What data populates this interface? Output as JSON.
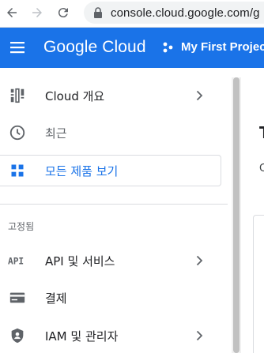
{
  "browser": {
    "url": "console.cloud.google.com/g",
    "back_icon": "arrow-left-icon",
    "forward_icon": "arrow-right-icon",
    "reload_icon": "reload-icon",
    "lock_icon": "lock-icon"
  },
  "header": {
    "bg_color": "#1a73e8",
    "logo_text": "Google Cloud",
    "project_label": "My First Project",
    "menu_icon": "hamburger-menu-icon",
    "project_icon": "project-dots-icon"
  },
  "sidenav": {
    "items": [
      {
        "label": "Cloud 개요",
        "icon": "dashboard-icon",
        "has_chevron": true
      },
      {
        "label": "최근",
        "icon": "clock-icon",
        "has_chevron": false
      },
      {
        "label": "모든 제품 보기",
        "icon": "grid-icon",
        "has_chevron": false
      }
    ],
    "pinned_section_label": "고정됨",
    "pinned_items": [
      {
        "label": "API 및 서비스",
        "icon": "api-icon",
        "has_chevron": true
      },
      {
        "label": "결제",
        "icon": "billing-icon",
        "has_chevron": false
      },
      {
        "label": "IAM 및 관리자",
        "icon": "shield-icon",
        "has_chevron": true
      }
    ]
  },
  "content_peek": {
    "title_fragment": "T",
    "subtitle_fragment": "C"
  }
}
